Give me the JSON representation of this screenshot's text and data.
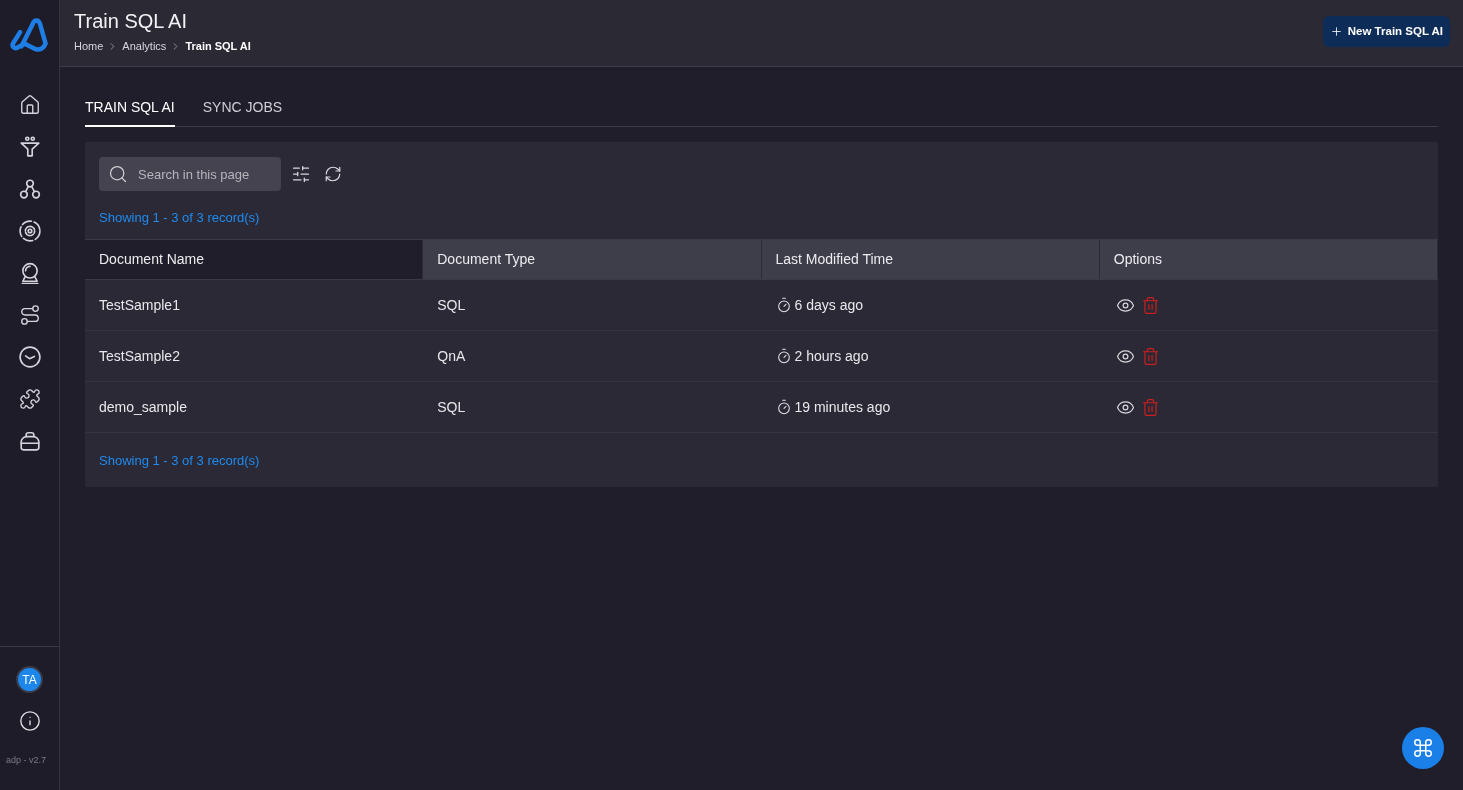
{
  "header": {
    "title": "Train SQL AI",
    "breadcrumbs": [
      {
        "label": "Home",
        "current": false
      },
      {
        "label": "Analytics",
        "current": false
      },
      {
        "label": "Train SQL AI",
        "current": true
      }
    ],
    "primary_button": {
      "label": "New Train SQL AI"
    }
  },
  "tabs": [
    {
      "label": "TRAIN SQL AI",
      "selected": true
    },
    {
      "label": "SYNC JOBS",
      "selected": false
    }
  ],
  "search": {
    "placeholder": "Search in this page"
  },
  "record_summary_top": "Showing 1 - 3 of 3 record(s)",
  "table": {
    "columns": [
      {
        "label": "Document Name",
        "active": true
      },
      {
        "label": "Document Type",
        "active": false
      },
      {
        "label": "Last Modified Time",
        "active": false
      },
      {
        "label": "Options",
        "active": false
      }
    ],
    "rows": [
      {
        "document_name": "TestSample1",
        "document_type": "SQL",
        "last_modified": "6 days ago"
      },
      {
        "document_name": "TestSample2",
        "document_type": "QnA",
        "last_modified": "2 hours ago"
      },
      {
        "document_name": "demo_sample",
        "document_type": "SQL",
        "last_modified": "19 minutes ago"
      }
    ]
  },
  "record_summary_bottom": "Showing 1 - 3 of 3 record(s)",
  "user": {
    "initials": "TA"
  },
  "version": "adp - v2.7"
}
